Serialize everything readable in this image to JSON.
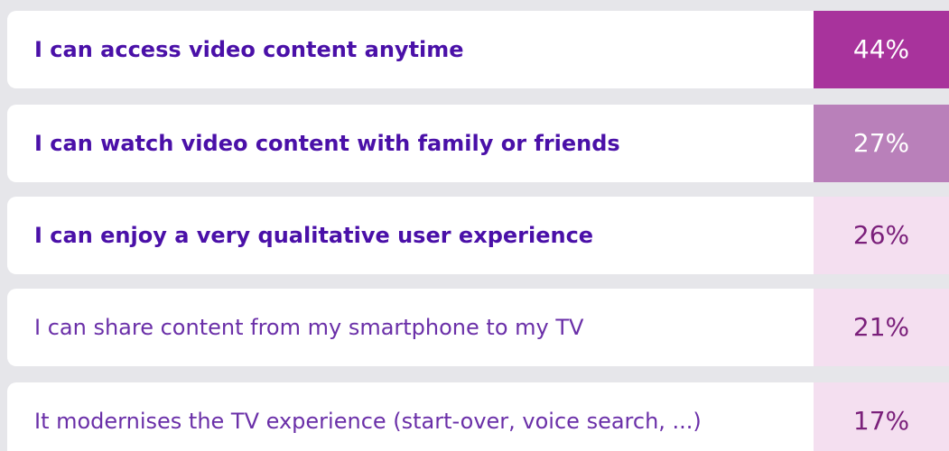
{
  "chart_data": {
    "type": "table",
    "rows": [
      {
        "label": "I can access video content anytime",
        "value": 44,
        "display": "44%",
        "cell_color": "#a8339c",
        "text_color": "#ffffff",
        "label_weight": "bold"
      },
      {
        "label": "I can watch video content with family or friends",
        "value": 27,
        "display": "27%",
        "cell_color": "#b980ba",
        "text_color": "#ffffff",
        "label_weight": "bold"
      },
      {
        "label": "I can enjoy a very qualitative user experience",
        "value": 26,
        "display": "26%",
        "cell_color": "#f4dff0",
        "text_color": "#7a1f7a",
        "label_weight": "medium"
      },
      {
        "label": "I can share content from my smartphone to my TV",
        "value": 21,
        "display": "21%",
        "cell_color": "#f4dff0",
        "text_color": "#7a1f7a",
        "label_weight": "regular"
      },
      {
        "label": "It modernises the TV experience (start-over, voice search, ...)",
        "value": 17,
        "display": "17%",
        "cell_color": "#f4dff0",
        "text_color": "#7a1f7a",
        "label_weight": "regular"
      }
    ]
  },
  "colors": {
    "background": "#e6e6ea",
    "row_background": "#ffffff",
    "label_text": "#4a10a8"
  }
}
